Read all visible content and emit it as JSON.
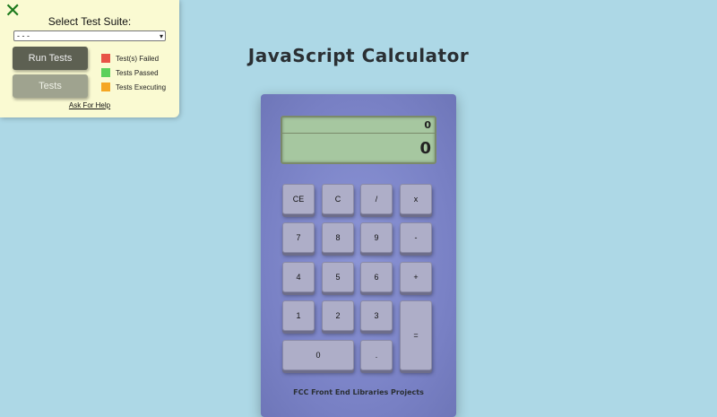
{
  "test_panel": {
    "close_icon": "close-x-icon",
    "suite_label": "Select Test Suite:",
    "suite_selected": "- - -",
    "run_button": "Run Tests",
    "tests_button": "Tests",
    "legend": [
      {
        "label": "Test(s) Failed",
        "color": "#e85347"
      },
      {
        "label": "Tests Passed",
        "color": "#5bd15b"
      },
      {
        "label": "Tests Executing",
        "color": "#f5a623"
      }
    ],
    "help_link": "Ask For Help"
  },
  "page": {
    "title": "JavaScript Calculator",
    "background": "#add8e6"
  },
  "calculator": {
    "formula": "0",
    "output": "0",
    "keys": {
      "clear_entry": "CE",
      "clear": "C",
      "divide": "/",
      "multiply": "x",
      "seven": "7",
      "eight": "8",
      "nine": "9",
      "subtract": "-",
      "four": "4",
      "five": "5",
      "six": "6",
      "add": "+",
      "one": "1",
      "two": "2",
      "three": "3",
      "equals": "=",
      "zero": "0",
      "decimal": "."
    },
    "footer": "FCC Front End Libraries Projects"
  }
}
